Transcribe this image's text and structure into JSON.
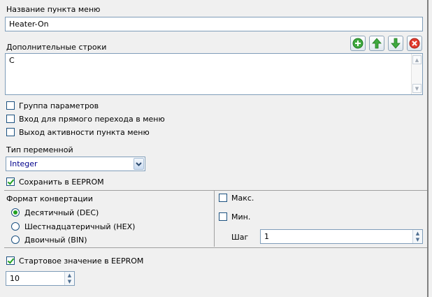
{
  "menu_item": {
    "name_label": "Название пункта меню",
    "name_value": "Heater-On"
  },
  "extra_lines": {
    "label": "Дополнительные строки",
    "value": "C",
    "toolbar": {
      "add_icon": "add-icon",
      "up_icon": "arrow-up-icon",
      "down_icon": "arrow-down-icon",
      "delete_icon": "delete-icon"
    }
  },
  "options": {
    "param_group": "Группа параметров",
    "direct_entry": "Вход для прямого перехода в меню",
    "activity_exit": "Выход активности пункта меню"
  },
  "variable_type": {
    "label": "Тип переменной",
    "selected": "Integer"
  },
  "save_eeprom": {
    "label": "Сохранить в EEPROM",
    "checked": true
  },
  "conversion": {
    "label": "Формат конвертации",
    "options": [
      {
        "label": "Десятичный (DEC)",
        "selected": true
      },
      {
        "label": "Шестнадцатеричный (HEX)",
        "selected": false
      },
      {
        "label": "Двоичный (BIN)",
        "selected": false
      }
    ]
  },
  "limits": {
    "max_label": "Макс.",
    "min_label": "Мин.",
    "step_label": "Шаг",
    "step_value": "1"
  },
  "start_value": {
    "label": "Стартовое значение в EEPROM",
    "checked": true,
    "value": "10"
  },
  "colors": {
    "accent_green": "#21a121",
    "border_blue": "#7f9db9",
    "selected_text_blue": "#00008b"
  }
}
